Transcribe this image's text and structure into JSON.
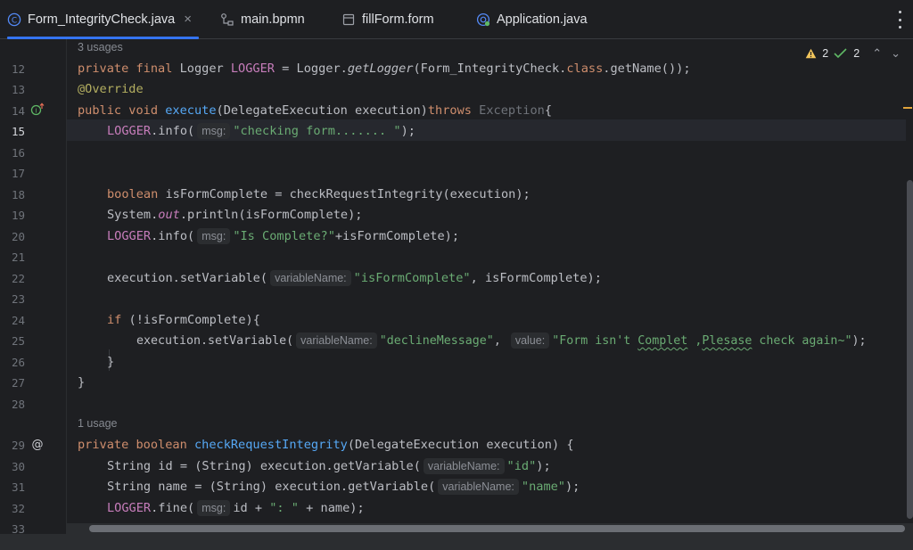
{
  "tabs": [
    {
      "label": "Form_IntegrityCheck.java",
      "icon": "java-class-icon",
      "active": true,
      "closable": true
    },
    {
      "label": "main.bpmn",
      "icon": "bpmn-icon",
      "active": false
    },
    {
      "label": "fillForm.form",
      "icon": "form-icon",
      "active": false
    },
    {
      "label": "Application.java",
      "icon": "spring-app-icon",
      "active": false
    }
  ],
  "close_glyph": "×",
  "inspections": {
    "warnings": "2",
    "ok": "2"
  },
  "usages": {
    "top": "3 usages",
    "method": "1 usage"
  },
  "line_numbers": {
    "l12": "12",
    "l13": "13",
    "l14": "14",
    "l15": "15",
    "l16": "16",
    "l17": "17",
    "l18": "18",
    "l19": "19",
    "l20": "20",
    "l21": "21",
    "l22": "22",
    "l23": "23",
    "l24": "24",
    "l25": "25",
    "l26": "26",
    "l27": "27",
    "l28": "28",
    "l29": "29",
    "l30": "30",
    "l31": "31",
    "l32": "32",
    "l33": "33"
  },
  "code": {
    "l12": {
      "kw1": "private final ",
      "t1": "Logger ",
      "f1": "LOGGER",
      "t2": " = Logger.",
      "m1": "getLogger",
      "t3": "(Form_IntegrityCheck.",
      "kw2": "class",
      "t4": ".getName());"
    },
    "l13": {
      "ann": "@Override"
    },
    "l14": {
      "kw1": "public void ",
      "fn": "execute",
      "t1": "(DelegateExecution execution)",
      "kw2": "throws",
      "t2": " Exception",
      "t3": "{"
    },
    "l15": {
      "f1": "LOGGER",
      "t1": ".info(",
      "hint": "msg:",
      "s1": "\"checking form....... \"",
      "t2": ");"
    },
    "l18": {
      "kw1": "boolean ",
      "t1": "isFormComplete = checkRequestIntegrity(execution);"
    },
    "l19": {
      "t1": "System.",
      "f1": "out",
      "t2": ".println(isFormComplete);"
    },
    "l20": {
      "f1": "LOGGER",
      "t1": ".info(",
      "hint": "msg:",
      "s1": "\"Is Complete?\"",
      "t2": "+isFormComplete);"
    },
    "l22": {
      "t1": "execution.setVariable(",
      "hint": "variableName:",
      "s1": "\"isFormComplete\"",
      "t2": ", isFormComplete);"
    },
    "l24": {
      "kw1": "if",
      "t1": " (!isFormComplete){"
    },
    "l25": {
      "t1": "execution.setVariable(",
      "hint1": "variableName:",
      "s1": "\"declineMessage\"",
      "t2": ", ",
      "hint2": "value:",
      "s2a": "\"Form isn't ",
      "s2b": "Complet",
      "s2c": " ,",
      "s2d": "Plesase",
      "s2e": " check again~\"",
      "t3": ");"
    },
    "l26": {
      "t1": "}"
    },
    "l27": {
      "t1": "}"
    },
    "l29": {
      "kw1": "private boolean ",
      "fn": "checkRequestIntegrity",
      "t1": "(DelegateExecution execution) {"
    },
    "l30": {
      "t1": "String id = (String) execution.getVariable(",
      "hint": "variableName:",
      "s1": "\"id\"",
      "t2": ");"
    },
    "l31": {
      "t1": "String name = (String) execution.getVariable(",
      "hint": "variableName:",
      "s1": "\"name\"",
      "t2": ");"
    },
    "l32": {
      "f1": "LOGGER",
      "t1": ".fine(",
      "hint": "msg:",
      "t2": "id + ",
      "s1": "\": \"",
      "t3": " + name);"
    }
  },
  "colors": {
    "accent": "#3574f0",
    "keyword": "#cf8e6d",
    "string": "#6aab73",
    "field": "#c77dbb",
    "function": "#56a8f5",
    "annotation": "#b3ae60"
  }
}
